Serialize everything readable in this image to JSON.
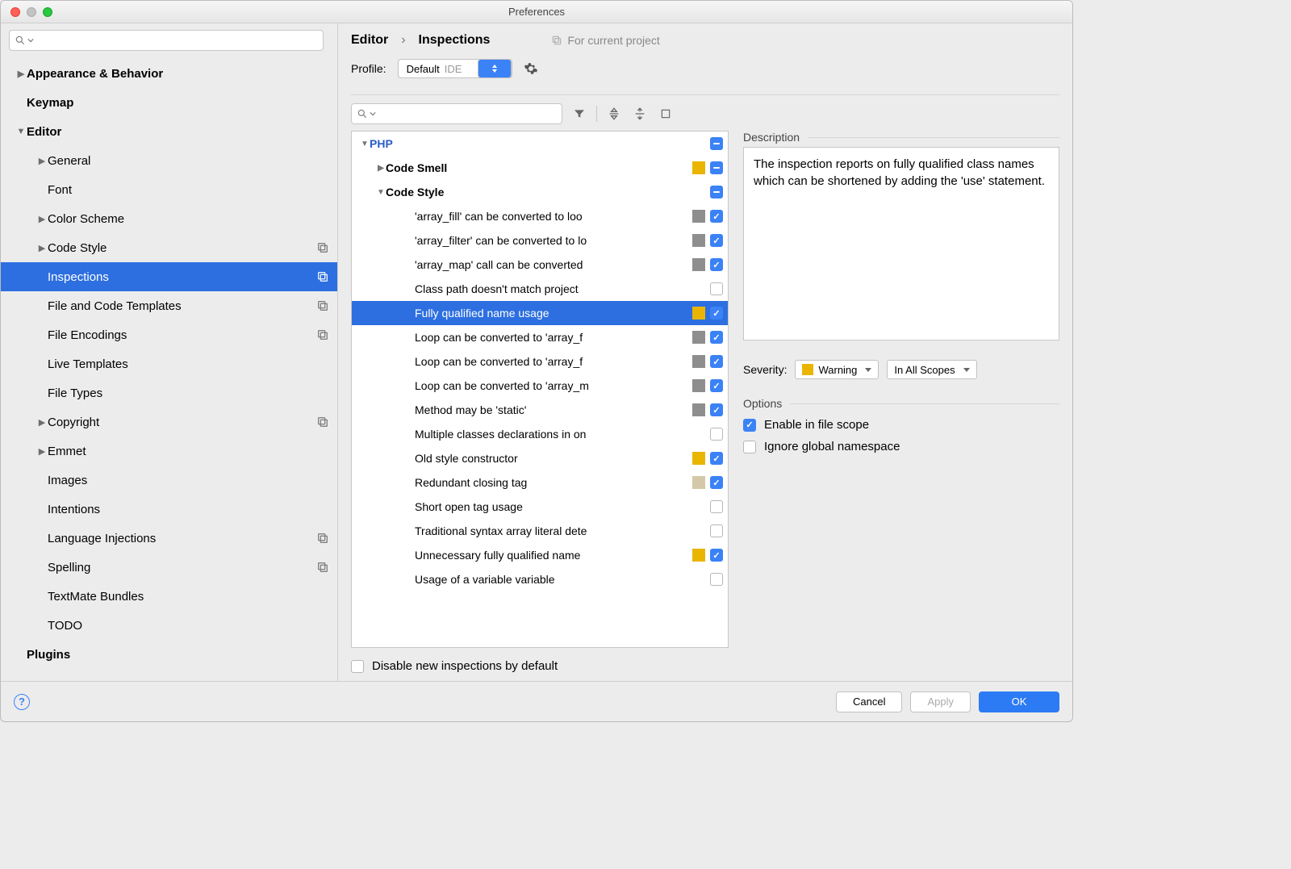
{
  "window": {
    "title": "Preferences"
  },
  "breadcrumb": {
    "parent": "Editor",
    "arrow": "›",
    "current": "Inspections",
    "scope": "For current project"
  },
  "profile": {
    "label": "Profile:",
    "value": "Default",
    "tag": "IDE"
  },
  "sidebar": {
    "items": [
      {
        "label": "Appearance & Behavior",
        "depth": 0,
        "arrow": "▶",
        "bold": true
      },
      {
        "label": "Keymap",
        "depth": 0,
        "bold": true
      },
      {
        "label": "Editor",
        "depth": 0,
        "arrow": "▼",
        "bold": true
      },
      {
        "label": "General",
        "depth": 1,
        "arrow": "▶"
      },
      {
        "label": "Font",
        "depth": 1
      },
      {
        "label": "Color Scheme",
        "depth": 1,
        "arrow": "▶"
      },
      {
        "label": "Code Style",
        "depth": 1,
        "arrow": "▶",
        "icon": true
      },
      {
        "label": "Inspections",
        "depth": 1,
        "icon": true,
        "selected": true
      },
      {
        "label": "File and Code Templates",
        "depth": 1,
        "icon": true
      },
      {
        "label": "File Encodings",
        "depth": 1,
        "icon": true
      },
      {
        "label": "Live Templates",
        "depth": 1
      },
      {
        "label": "File Types",
        "depth": 1
      },
      {
        "label": "Copyright",
        "depth": 1,
        "arrow": "▶",
        "icon": true
      },
      {
        "label": "Emmet",
        "depth": 1,
        "arrow": "▶"
      },
      {
        "label": "Images",
        "depth": 1
      },
      {
        "label": "Intentions",
        "depth": 1
      },
      {
        "label": "Language Injections",
        "depth": 1,
        "icon": true
      },
      {
        "label": "Spelling",
        "depth": 1,
        "icon": true
      },
      {
        "label": "TextMate Bundles",
        "depth": 1
      },
      {
        "label": "TODO",
        "depth": 1
      },
      {
        "label": "Plugins",
        "depth": 0,
        "bold": true
      }
    ]
  },
  "inspections": {
    "items": [
      {
        "label": "PHP",
        "level": 0,
        "arrow": "▼",
        "cb": "mix"
      },
      {
        "label": "Code Smell",
        "level": 1,
        "arrow": "▶",
        "sev": "yellow",
        "cb": "mix"
      },
      {
        "label": "Code Style",
        "level": 1,
        "arrow": "▼",
        "cb": "mix"
      },
      {
        "label": "'array_fill' can be converted to loo",
        "level": 2,
        "sev": "gray",
        "cb": "on"
      },
      {
        "label": "'array_filter' can be converted to lo",
        "level": 2,
        "sev": "gray",
        "cb": "on"
      },
      {
        "label": "'array_map' call can be converted ",
        "level": 2,
        "sev": "gray",
        "cb": "on"
      },
      {
        "label": "Class path doesn't match project ",
        "level": 2,
        "sev": "none",
        "cb": "off"
      },
      {
        "label": "Fully qualified name usage",
        "level": 2,
        "sev": "yellow",
        "cb": "on",
        "selected": true
      },
      {
        "label": "Loop can be converted to 'array_f",
        "level": 2,
        "sev": "gray",
        "cb": "on"
      },
      {
        "label": "Loop can be converted to 'array_f",
        "level": 2,
        "sev": "gray",
        "cb": "on"
      },
      {
        "label": "Loop can be converted to 'array_m",
        "level": 2,
        "sev": "gray",
        "cb": "on"
      },
      {
        "label": "Method may be 'static'",
        "level": 2,
        "sev": "gray",
        "cb": "on"
      },
      {
        "label": "Multiple classes declarations in on",
        "level": 2,
        "sev": "none",
        "cb": "off"
      },
      {
        "label": "Old style constructor",
        "level": 2,
        "sev": "yellow",
        "cb": "on"
      },
      {
        "label": "Redundant closing tag",
        "level": 2,
        "sev": "beige",
        "cb": "on"
      },
      {
        "label": "Short open tag usage",
        "level": 2,
        "sev": "none",
        "cb": "off"
      },
      {
        "label": "Traditional syntax array literal dete",
        "level": 2,
        "sev": "none",
        "cb": "off"
      },
      {
        "label": "Unnecessary fully qualified name",
        "level": 2,
        "sev": "yellow",
        "cb": "on"
      },
      {
        "label": "Usage of a variable variable",
        "level": 2,
        "sev": "none",
        "cb": "off"
      }
    ]
  },
  "description": {
    "header": "Description",
    "text": "The inspection reports on fully qualified class names which can be shortened by adding the 'use' statement."
  },
  "severity": {
    "label": "Severity:",
    "value": "Warning",
    "scope": "In All Scopes"
  },
  "options": {
    "header": "Options",
    "opt1": "Enable in file scope",
    "opt2": "Ignore global namespace"
  },
  "disable": {
    "label": "Disable new inspections by default"
  },
  "footer": {
    "cancel": "Cancel",
    "apply": "Apply",
    "ok": "OK"
  }
}
